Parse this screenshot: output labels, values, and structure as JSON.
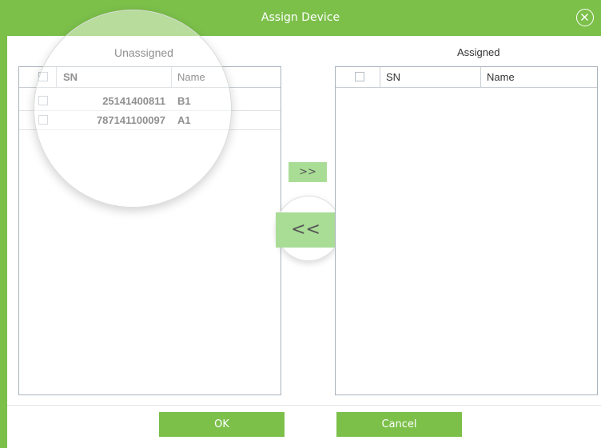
{
  "dialog": {
    "title": "Assign Device",
    "close_icon": "close-circle-icon"
  },
  "unassigned": {
    "label": "Unassigned",
    "columns": [
      "SN",
      "Name"
    ],
    "rows": [
      {
        "sn": "25141400811",
        "name": "B1"
      },
      {
        "sn": "787141100097",
        "name": "A1"
      }
    ]
  },
  "assigned": {
    "label": "Assigned",
    "columns": [
      "SN",
      "Name"
    ],
    "rows": []
  },
  "transfer": {
    "move_right_label": ">>",
    "move_left_label": "<<"
  },
  "footer": {
    "ok_label": "OK",
    "cancel_label": "Cancel"
  },
  "colors": {
    "accent": "#7cc04a",
    "transfer_button": "#a9dd96"
  }
}
